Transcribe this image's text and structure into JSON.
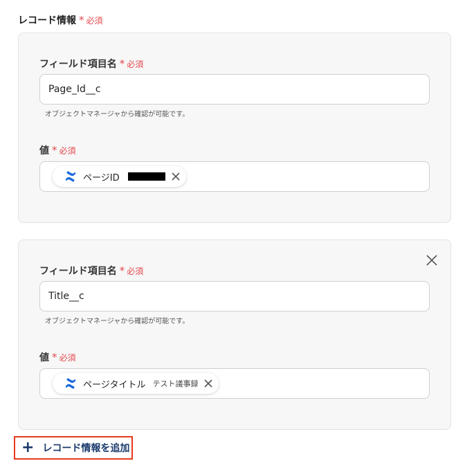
{
  "section": {
    "title": "レコード情報",
    "required": "必須"
  },
  "records": [
    {
      "field_label": "フィールド項目名",
      "field_required": "必須",
      "field_value": "Page_Id__c",
      "hint": "オブジェクトマネージャから確認が可能です。",
      "value_label": "値",
      "value_required": "必須",
      "chip_label": "ページID",
      "chip_value": ""
    },
    {
      "field_label": "フィールド項目名",
      "field_required": "必須",
      "field_value": "Title__c",
      "hint": "オブジェクトマネージャから確認が可能です。",
      "value_label": "値",
      "value_required": "必須",
      "chip_label": "ページタイトル",
      "chip_value": "テスト議事録"
    }
  ],
  "add_button": {
    "label": "レコード情報を追加"
  },
  "colors": {
    "required": "#e5484d",
    "accent_border": "#e8391f",
    "link": "#1a3a6b",
    "confluence_blue": "#1868db"
  },
  "icons": {
    "chip_icon": "confluence-logo-icon",
    "remove": "close-icon",
    "add": "plus-icon"
  }
}
